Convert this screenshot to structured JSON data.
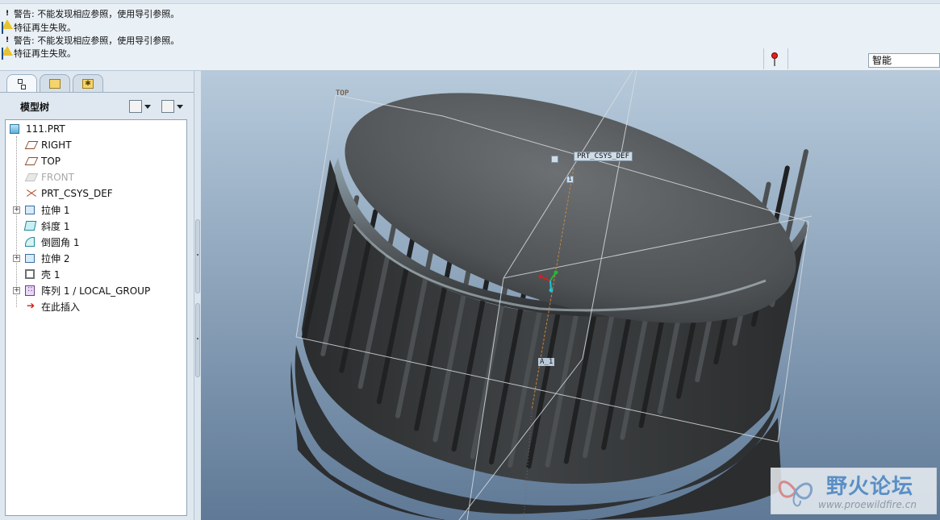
{
  "messages": [
    {
      "type": "warning",
      "icon": "warning-icon",
      "text": "警告: 不能发现相应参照，使用导引参照。"
    },
    {
      "type": "failure",
      "icon": "feature-failed-icon",
      "text": "特征再生失败。"
    },
    {
      "type": "warning",
      "icon": "warning-icon",
      "text": "警告: 不能发现相应参照，使用导引参照。"
    },
    {
      "type": "failure",
      "icon": "feature-failed-icon",
      "text": "特征再生失败。"
    }
  ],
  "filter": {
    "selected": "智能"
  },
  "panel": {
    "tabs": [
      {
        "name": "model-tree",
        "icon": "model-tree-icon",
        "active": true
      },
      {
        "name": "folder-browser",
        "icon": "folder-browser-icon",
        "active": false
      },
      {
        "name": "favorites",
        "icon": "favorites-icon",
        "active": false
      }
    ],
    "title": "模型树"
  },
  "tree": {
    "root": "111.PRT",
    "items": [
      {
        "label": "RIGHT",
        "icon": "datum-plane-icon",
        "expandable": false,
        "suppressed": false
      },
      {
        "label": "TOP",
        "icon": "datum-plane-icon",
        "expandable": false,
        "suppressed": false
      },
      {
        "label": "FRONT",
        "icon": "datum-plane-icon",
        "expandable": false,
        "suppressed": true
      },
      {
        "label": "PRT_CSYS_DEF",
        "icon": "coordinate-system-icon",
        "expandable": false,
        "suppressed": false
      },
      {
        "label": "拉伸 1",
        "icon": "extrude-icon",
        "expandable": true,
        "suppressed": false
      },
      {
        "label": "斜度 1",
        "icon": "draft-icon",
        "expandable": false,
        "suppressed": false
      },
      {
        "label": "倒圆角 1",
        "icon": "round-icon",
        "expandable": false,
        "suppressed": false
      },
      {
        "label": "拉伸 2",
        "icon": "extrude-icon",
        "expandable": true,
        "suppressed": false
      },
      {
        "label": "壳 1",
        "icon": "shell-icon",
        "expandable": false,
        "suppressed": false
      },
      {
        "label": "阵列 1 / LOCAL_GROUP",
        "icon": "pattern-icon",
        "expandable": true,
        "suppressed": false
      },
      {
        "label": "在此插入",
        "icon": "insert-here-icon",
        "expandable": false,
        "suppressed": false
      }
    ]
  },
  "viewport": {
    "datum_label": "TOP",
    "csys_label": "PRT_CSYS_DEF",
    "axis_tag": "1",
    "annotation": "A_1"
  },
  "watermark": {
    "title": "野火论坛",
    "url": "www.proewildfire.cn"
  },
  "colors": {
    "viewport_top": "#b4c9dc",
    "viewport_bottom": "#5f7896",
    "model_dark": "#383b3d",
    "warning": "#f0c419",
    "failure": "#2b6fb6",
    "status_light": "#dd2222"
  }
}
